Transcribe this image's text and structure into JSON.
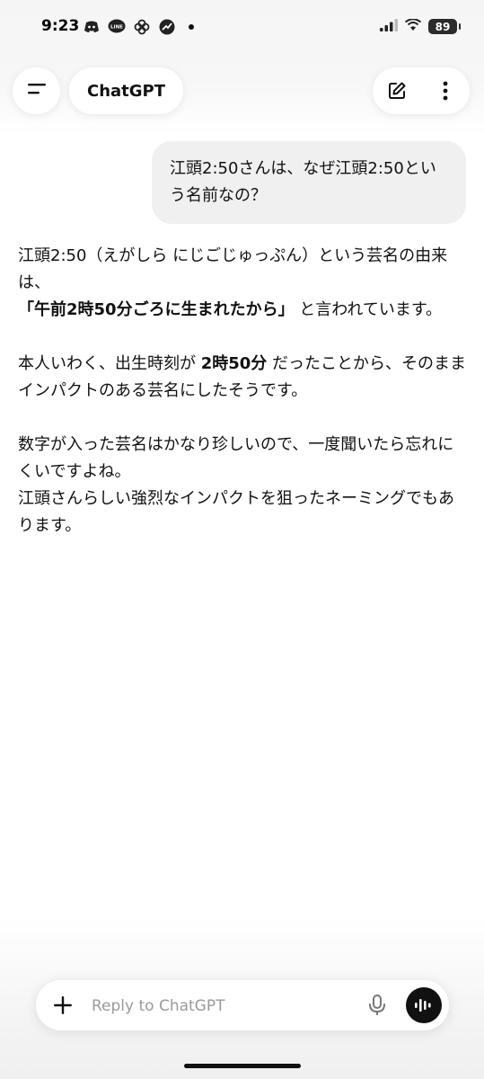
{
  "status": {
    "time": "9:23",
    "battery": "89"
  },
  "header": {
    "title": "ChatGPT"
  },
  "messages": {
    "user": "江頭2:50さんは、なぜ江頭2:50という名前なの？",
    "assistant": {
      "p1_line1": "江頭2:50（えがしら にじごじゅっぷん）という芸名の由来は、",
      "p1_bold": "「午前2時50分ごろに生まれたから」",
      "p1_rest": " と言われています。",
      "p2_pre": "本人いわく、出生時刻が ",
      "p2_bold": "2時50分",
      "p2_post": " だったことから、そのままインパクトのある芸名にしたそうです。",
      "p3_line1": "数字が入った芸名はかなり珍しいので、一度聞いたら忘れにくいですよね。",
      "p3_line2": "江頭さんらしい強烈なインパクトを狙ったネーミングでもあります。"
    }
  },
  "composer": {
    "placeholder": "Reply to ChatGPT"
  },
  "icons": {
    "menu": "menu-icon",
    "new_chat": "edit-icon",
    "more": "more-vertical-icon",
    "plus": "plus-icon",
    "mic": "mic-icon",
    "voice": "voice-waveform-icon"
  }
}
